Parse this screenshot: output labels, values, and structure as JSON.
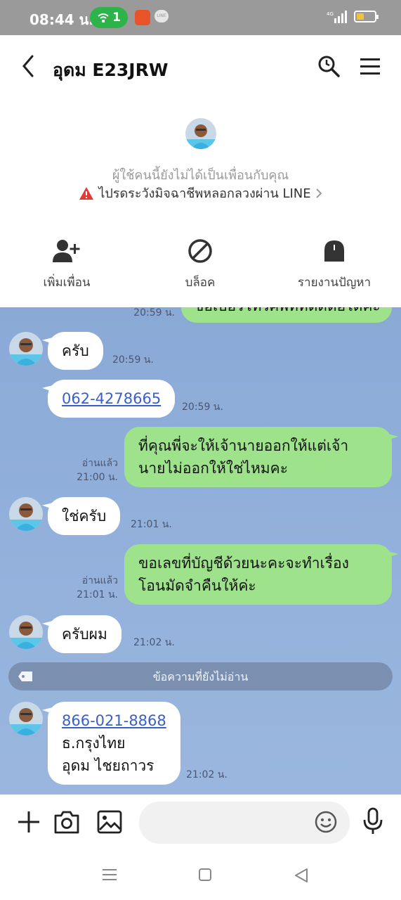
{
  "status_bar": {
    "time": "08:44 น.",
    "wifi_count": "1",
    "app_badge": "LINE",
    "network": "4G"
  },
  "header": {
    "title": "อุดม E23JRW",
    "icons": [
      "back-icon",
      "search-icon",
      "menu-icon"
    ]
  },
  "profile": {
    "notice": "ผู้ใช้คนนี้ยังไม่ได้เป็นเพื่อนกับคุณ",
    "warning": "ไปรดระวังมิจฉาชีพหลอกลวงผ่าน LINE",
    "actions": [
      {
        "label": "เพิ่มเพื่อน",
        "icon": "add-friend-icon"
      },
      {
        "label": "บล็อค",
        "icon": "block-icon"
      },
      {
        "label": "รายงานปัญหา",
        "icon": "report-icon"
      }
    ]
  },
  "chat": {
    "partial_time": "20:59 น.",
    "partial_text": "ขอเบอร์โทรศัพท์ที่ติดต่อได้คะ",
    "messages": [
      {
        "text": "ครับ",
        "time": "20:59 น."
      },
      {
        "text": "062-4278665",
        "time": "20:59 น."
      },
      {
        "text_line1": "ที่คุณพี่จะให้เจ้านายออกให้แต่เจ้า",
        "text_line2": "นายไม่ออกให้ใช่ไหมคะ",
        "read": "อ่านแล้ว",
        "time": "21:00 น."
      },
      {
        "text": "ใช่ครับ",
        "time": "21:01 น."
      },
      {
        "text_line1": "ขอเลขที่บัญชีด้วยนะคะจะทำเรื่อง",
        "text_line2": "โอนมัดจำคืนให้ค่ะ",
        "read": "อ่านแล้ว",
        "time": "21:01 น."
      },
      {
        "text": "ครับผม",
        "time": "21:02 น."
      },
      {
        "link": "866-021-8868",
        "line2": "ธ.กรุงไทย",
        "line3": "อุดม ไชยถาวร",
        "time": "21:02 น."
      }
    ],
    "unread_label": "ข้อความที่ยังไม่อ่าน"
  },
  "input": {
    "placeholder": ""
  },
  "colors": {
    "chat_bg": "#8aa9d6",
    "outgoing": "#9ee38b",
    "link": "#3a5fc8",
    "warning": "#e53935"
  }
}
